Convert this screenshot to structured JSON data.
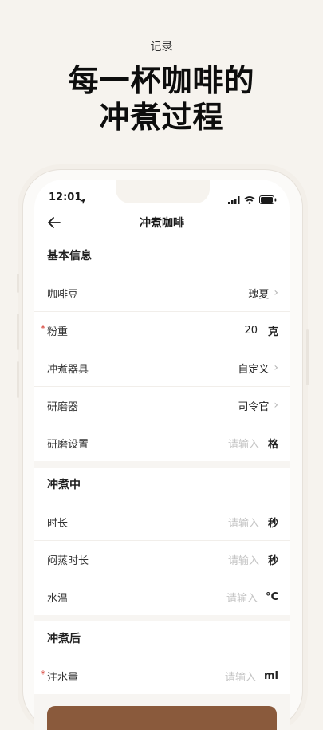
{
  "promo": {
    "label": "记录",
    "title_line1": "每一杯咖啡的",
    "title_line2": "冲煮过程"
  },
  "statusbar": {
    "time": "12:01"
  },
  "navbar": {
    "title": "冲煮咖啡"
  },
  "sections": {
    "basic": {
      "title": "基本信息",
      "bean": {
        "label": "咖啡豆",
        "value": "瑰夏"
      },
      "dose": {
        "label": "粉重",
        "value": "20",
        "unit": "克"
      },
      "brewer": {
        "label": "冲煮器具",
        "value": "自定义"
      },
      "grinder": {
        "label": "研磨器",
        "value": "司令官"
      },
      "grind_setting": {
        "label": "研磨设置",
        "placeholder": "请输入",
        "unit": "格"
      }
    },
    "brewing": {
      "title": "冲煮中",
      "duration": {
        "label": "时长",
        "placeholder": "请输入",
        "unit": "秒"
      },
      "bloom": {
        "label": "闷蒸时长",
        "placeholder": "请输入",
        "unit": "秒"
      },
      "water_temp": {
        "label": "水温",
        "placeholder": "请输入",
        "unit": "°C"
      }
    },
    "after": {
      "title": "冲煮后",
      "water_volume": {
        "label": "注水量",
        "placeholder": "请输入",
        "unit": "ml"
      }
    }
  },
  "required_mark": "*",
  "colors": {
    "background": "#f6f3ee",
    "accent_button": "#8a5a3c",
    "required": "#d7443a"
  }
}
